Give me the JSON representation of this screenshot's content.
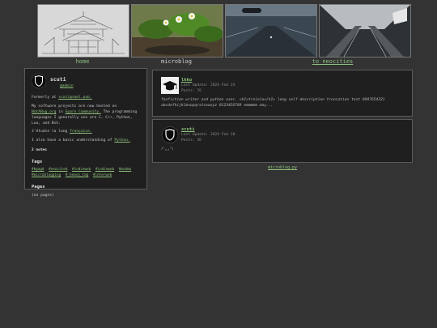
{
  "nav": {
    "home_label": "home",
    "microblog_label": "microblog",
    "neocities_label": "to neocities"
  },
  "sidebar": {
    "name": "scuti",
    "handle": "@admin",
    "formerly_prefix": "Formerly at",
    "formerly_link": "scuti@smol.pub.",
    "bio_line": "My software projects are now hosted on",
    "bio_link1": "NotABug.org",
    "bio_mid": "in",
    "bio_link2": "Sparx Community.",
    "bio_tail": "The programming languages I generally use are C, C++, Python, Lua, and Bsh.",
    "study_prefix": "J'étudie la lang",
    "study_link": "française.",
    "study2_prefix": "I also have a basic understanding of",
    "study2_link": "Python.",
    "notes_count": "2 notes",
    "tags_heading": "Tags",
    "tags": [
      "#bgagd",
      "#neocited",
      "#indieweb",
      "#indieweb",
      "#mudmo",
      "#microblogging",
      "#_heavy_tag",
      "#interweb"
    ],
    "pages_heading": "Pages",
    "pages_empty": "(no pages)"
  },
  "posts": [
    {
      "author": "lkko",
      "updated": "Last Update: 2024 Feb 24",
      "posts_count": "Posts: 76",
      "body": "fanfiction writer and python user. <h1>trololo</h1> long self-description truncation test 0987654321 abcdefhijklmnopqrstuvwxyz 0123456789 emmmmm may..."
    },
    {
      "author": "scuti",
      "updated": "Last Update: 2024 Feb 10",
      "posts_count": "Posts: 36",
      "body": "/ᐠ｡ꞈ｡ᐟ\\"
    }
  ],
  "footer": {
    "link": "microblog.py"
  }
}
